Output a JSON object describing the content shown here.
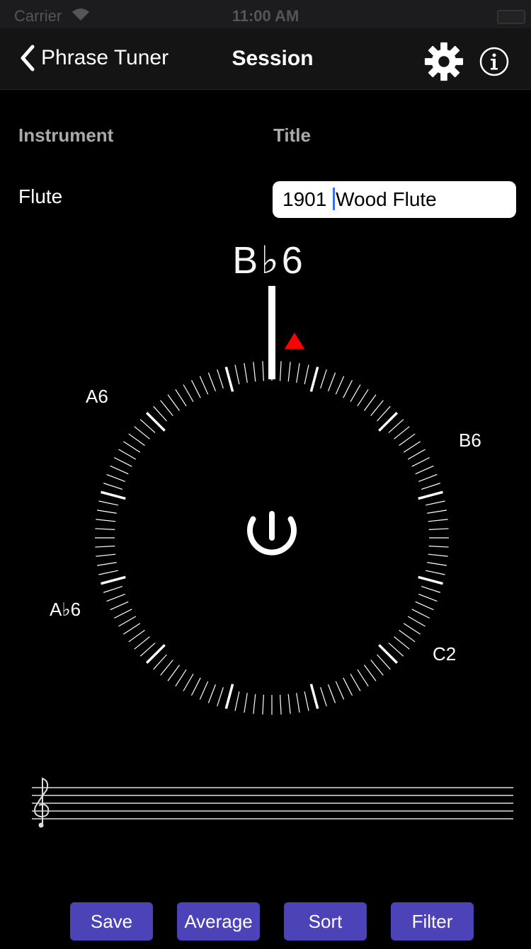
{
  "status_bar": {
    "carrier": "Carrier",
    "time": "11:00 AM"
  },
  "nav": {
    "back_label": "Phrase Tuner",
    "title": "Session"
  },
  "form": {
    "instrument_label": "Instrument",
    "title_label": "Title",
    "instrument_value": "Flute",
    "title_value_before_caret": "1901 ",
    "title_value_after_caret": "Wood Flute"
  },
  "tuner": {
    "note": "B♭6",
    "labels": {
      "upper_left": "A6",
      "right": "B6",
      "lower_left": "A♭6",
      "lower_right": "C2"
    }
  },
  "buttons": {
    "save": "Save",
    "average": "Average",
    "sort": "Sort",
    "filter": "Filter"
  },
  "colors": {
    "accent": "#4c43b8",
    "indicator": "#ff0000",
    "caret": "#3b6ef5"
  }
}
